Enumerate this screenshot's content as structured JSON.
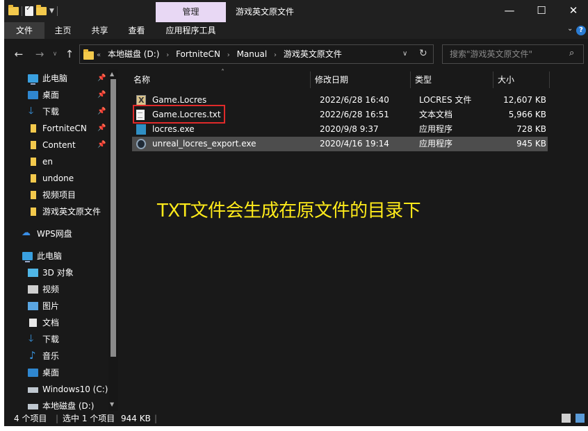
{
  "window": {
    "title": "游戏英文原文件",
    "context_tab": "管理",
    "minimize": "—",
    "maximize": "☐",
    "close": "✕"
  },
  "ribbon": {
    "tabs": [
      "文件",
      "主页",
      "共享",
      "查看",
      "应用程序工具"
    ],
    "active_tab": 0
  },
  "address": {
    "crumbs": [
      "本地磁盘 (D:)",
      "FortniteCN",
      "Manual",
      "游戏英文原文件"
    ],
    "overflow": "«"
  },
  "search": {
    "placeholder": "搜索\"游戏英文原文件\""
  },
  "sidebar": {
    "quick_access": [
      {
        "label": "此电脑",
        "icon": "pc-icon",
        "pinned": true
      },
      {
        "label": "桌面",
        "icon": "desktop-icon",
        "pinned": true
      },
      {
        "label": "下载",
        "icon": "download-icon",
        "pinned": true
      },
      {
        "label": "FortniteCN",
        "icon": "folder-icon",
        "pinned": true
      },
      {
        "label": "Content",
        "icon": "folder-icon",
        "pinned": true
      },
      {
        "label": "en",
        "icon": "folder-icon",
        "pinned": false
      },
      {
        "label": "undone",
        "icon": "folder-icon",
        "pinned": false
      },
      {
        "label": "视频项目",
        "icon": "folder-icon",
        "pinned": false
      },
      {
        "label": "游戏英文原文件",
        "icon": "folder-icon",
        "pinned": false
      }
    ],
    "wps": "WPS网盘",
    "this_pc": "此电脑",
    "pc_items": [
      {
        "label": "3D 对象",
        "icon": "cube-icon"
      },
      {
        "label": "视频",
        "icon": "video-icon"
      },
      {
        "label": "图片",
        "icon": "picture-icon"
      },
      {
        "label": "文档",
        "icon": "document-icon"
      },
      {
        "label": "下载",
        "icon": "download-icon"
      },
      {
        "label": "音乐",
        "icon": "music-icon"
      },
      {
        "label": "桌面",
        "icon": "desktop-icon"
      },
      {
        "label": "Windows10 (C:)",
        "icon": "drive-icon"
      },
      {
        "label": "本地磁盘 (D:)",
        "icon": "drive-icon"
      }
    ]
  },
  "columns": {
    "name": "名称",
    "date": "修改日期",
    "type": "类型",
    "size": "大小"
  },
  "files": [
    {
      "name": "Game.Locres",
      "date": "2022/6/28 16:40",
      "type": "LOCRES 文件",
      "size": "12,607 KB",
      "icon": "locres-file-icon",
      "selected": false
    },
    {
      "name": "Game.Locres.txt",
      "date": "2022/6/28 16:51",
      "type": "文本文档",
      "size": "5,966 KB",
      "icon": "text-file-icon",
      "selected": false
    },
    {
      "name": "locres.exe",
      "date": "2020/9/8 9:37",
      "type": "应用程序",
      "size": "728 KB",
      "icon": "exe-icon",
      "selected": false
    },
    {
      "name": "unreal_locres_export.exe",
      "date": "2020/4/16 19:14",
      "type": "应用程序",
      "size": "945 KB",
      "icon": "unreal-exe-icon",
      "selected": true
    }
  ],
  "annotation": "TXT文件会生成在原文件的目录下",
  "status": {
    "count": "4 个项目",
    "selection": "选中 1 个项目",
    "size": "944 KB"
  },
  "colors": {
    "background": "#191919",
    "annotation": "#ffeb1a",
    "highlight": "#e02a2a",
    "context_tab": "#e8d8f4"
  }
}
